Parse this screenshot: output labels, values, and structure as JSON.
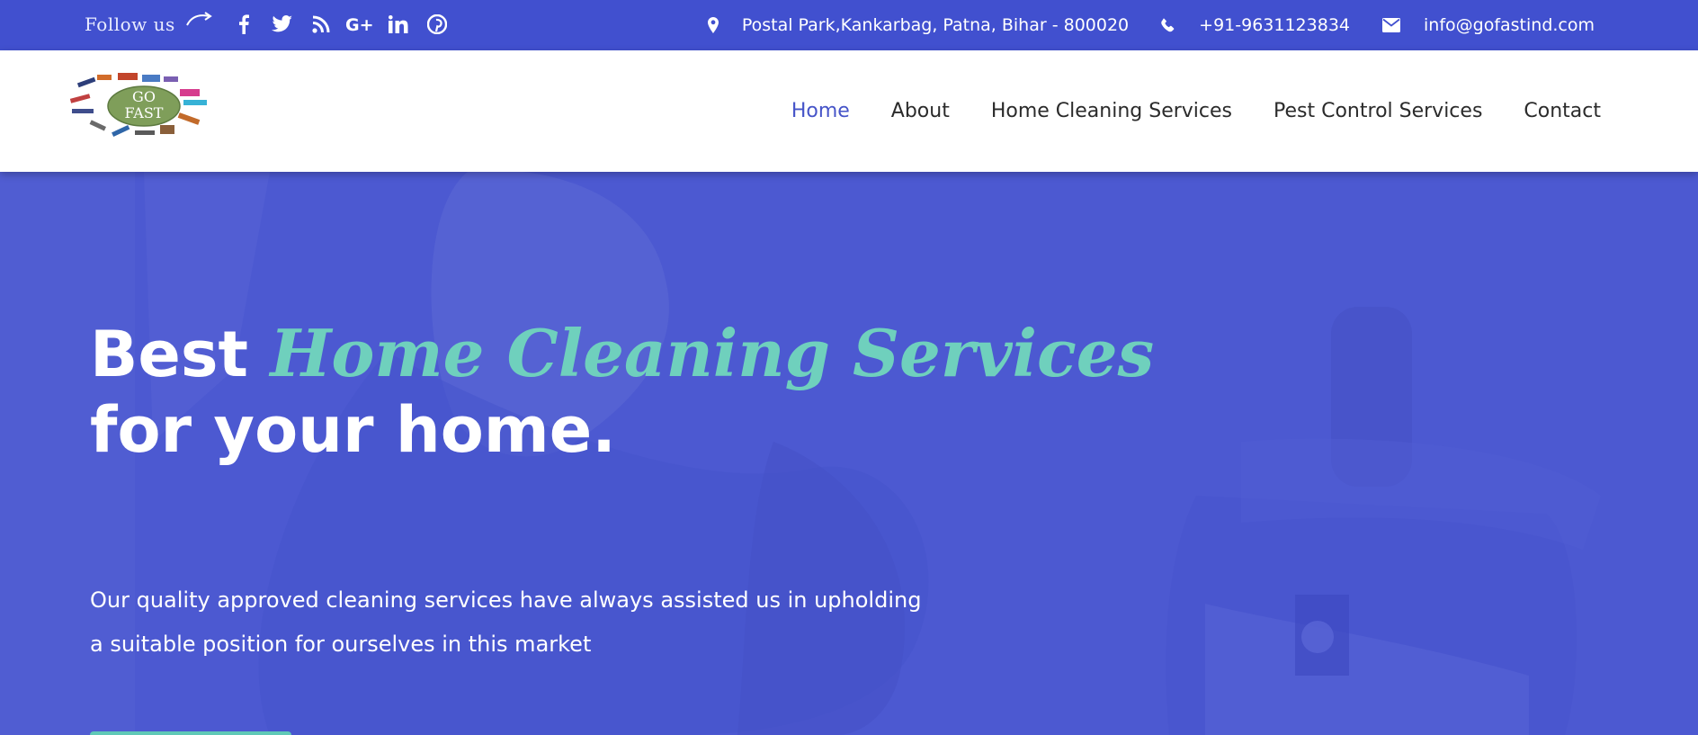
{
  "topbar": {
    "follow_text": "Follow us",
    "social_icons": [
      "facebook-icon",
      "twitter-icon",
      "rss-icon",
      "google-plus-icon",
      "linkedin-icon",
      "pinterest-icon"
    ],
    "address": "Postal Park,Kankarbag, Patna, Bihar - 800020",
    "phone": "+91-9631123834",
    "email": "info@gofastind.com",
    "background_color": "#4150cf"
  },
  "header": {
    "logo_text_line1": "GO",
    "logo_text_line2": "FAST",
    "nav": [
      {
        "label": "Home",
        "active": true
      },
      {
        "label": "About",
        "active": false
      },
      {
        "label": "Home Cleaning Services",
        "active": false
      },
      {
        "label": "Pest Control Services",
        "active": false
      },
      {
        "label": "Contact",
        "active": false
      }
    ],
    "active_color": "#4654c8"
  },
  "hero": {
    "title_prefix": "Best ",
    "title_accent": "Home Cleaning Services",
    "title_line2": "for your home.",
    "subtitle_line1": "Our quality approved cleaning services have always assisted us in upholding",
    "subtitle_line2": "a suitable position for ourselves in this market",
    "accent_color": "#6fd0bd",
    "overlay_color": "#4a57cf"
  }
}
